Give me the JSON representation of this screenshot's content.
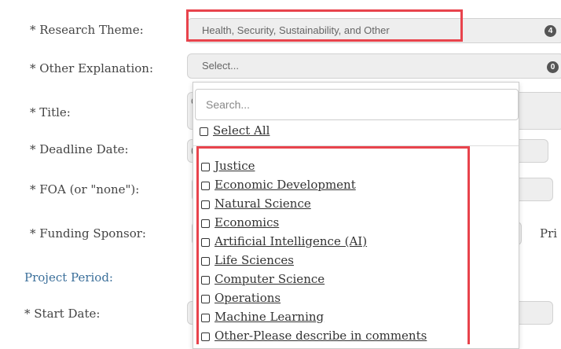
{
  "form": {
    "research_theme": {
      "label": "* Research Theme:",
      "value": "Health, Security, Sustainability, and Other",
      "badge": "4"
    },
    "other_explanation": {
      "label": "* Other Explanation:",
      "placeholder": "Select...",
      "badge": "0"
    },
    "title": {
      "label": "* Title:",
      "hint": "C"
    },
    "deadline": {
      "label": "* Deadline Date:",
      "hint": "("
    },
    "foa": {
      "label": "* FOA (or \"none\"):"
    },
    "sponsor": {
      "label": "* Funding Sponsor:",
      "right_text": "Pri"
    },
    "project_period": {
      "heading": "Project Period:"
    },
    "start_date": {
      "label": "* Start Date:"
    }
  },
  "dropdown": {
    "search_placeholder": "Search...",
    "select_all": "Select All",
    "options": [
      "Justice",
      "Economic Development",
      "Natural Science",
      "Economics",
      "Artificial Intelligence (AI)",
      "Life Sciences",
      "Computer Science",
      "Operations",
      "Machine Learning",
      "Other-Please describe in comments"
    ]
  },
  "colors": {
    "highlight": "#e8434c",
    "section": "#3b6f9a"
  }
}
